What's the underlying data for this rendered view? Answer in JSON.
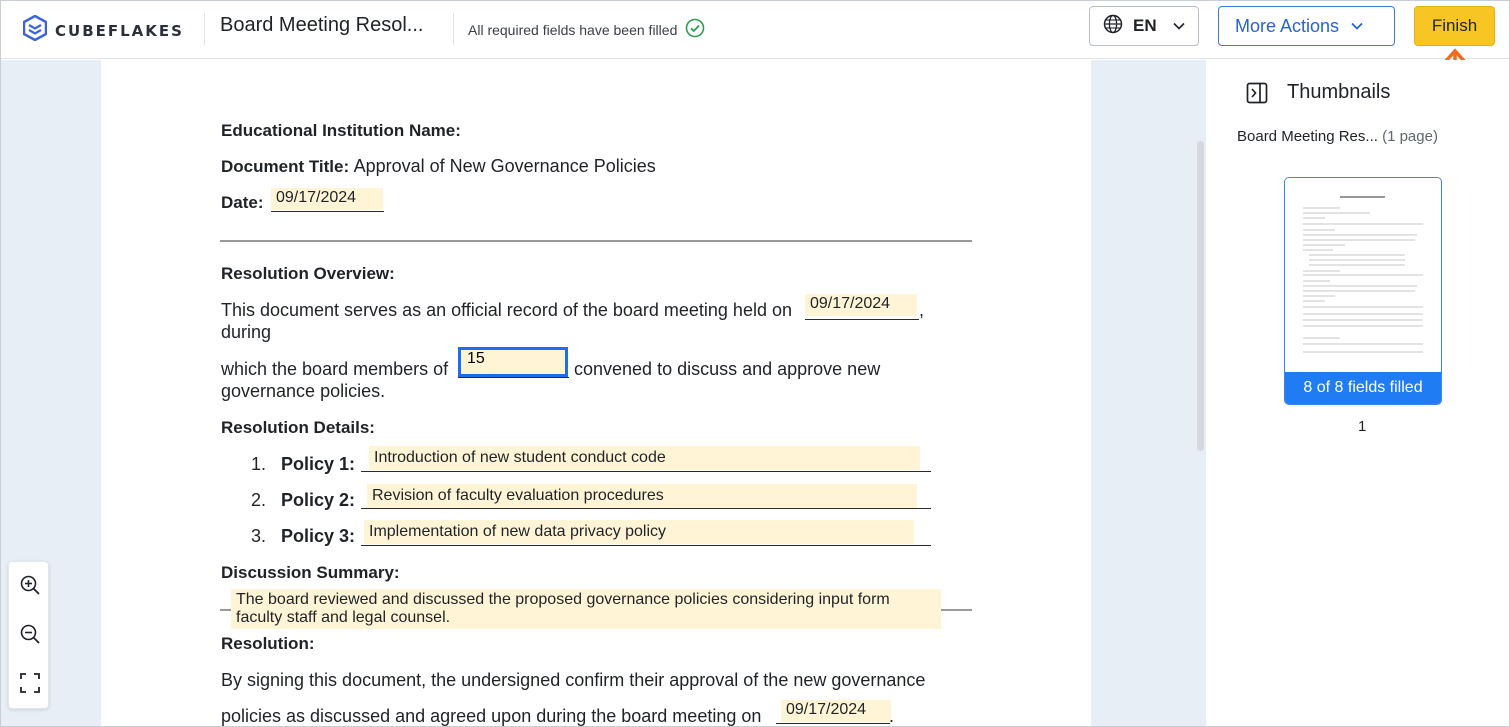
{
  "header": {
    "brand": "CUBEFLAKES",
    "doc_title": "Board Meeting Resol...",
    "status_text": "All required fields have been filled",
    "language": "EN",
    "more_actions_label": "More Actions",
    "finish_label": "Finish"
  },
  "document": {
    "institution_label": "Educational Institution Name:",
    "doc_title_label": "Document Title:",
    "doc_title_value": "Approval of New Governance Policies",
    "date_label": "Date:",
    "date_value": "09/17/2024",
    "overview_heading": "Resolution Overview:",
    "overview_line1": "This document serves as an official record of the board meeting held on",
    "meeting_date_value": "09/17/2024",
    "overview_line1_end": ",",
    "overview_line2": "during",
    "overview_line3_start": "which the board members of",
    "members_value": "15",
    "overview_line3_end": "convened to discuss and approve new",
    "overview_line4": "governance policies.",
    "details_heading": "Resolution Details:",
    "policies": [
      {
        "num": "1.",
        "label": "Policy 1:",
        "value": "Introduction of new student conduct code"
      },
      {
        "num": "2.",
        "label": "Policy 2:",
        "value": "Revision of faculty evaluation procedures"
      },
      {
        "num": "3.",
        "label": "Policy 3:",
        "value": "Implementation of new data privacy policy"
      }
    ],
    "discussion_heading": "Discussion Summary:",
    "discussion_line1": "The board reviewed and discussed the proposed governance policies considering input form",
    "discussion_line2": "faculty staff and legal counsel.",
    "resolution_heading": "Resolution:",
    "resolution_line1": "By signing this document, the undersigned confirm their approval of the new governance",
    "resolution_line2": "policies as discussed and agreed upon during the board meeting on",
    "resolution_date_value": "09/17/2024",
    "resolution_line2_end": "."
  },
  "panel": {
    "title": "Thumbnails",
    "doc_name": "Board Meeting Res...",
    "page_count": "(1 page)",
    "fields_filled": "8 of 8 fields filled",
    "page_number": "1"
  },
  "colors": {
    "accent": "#1f7cf2",
    "finish": "#f7c624",
    "field_fill": "#fff5d6",
    "success": "#2e9e4f",
    "arrow": "#f26b1d"
  }
}
